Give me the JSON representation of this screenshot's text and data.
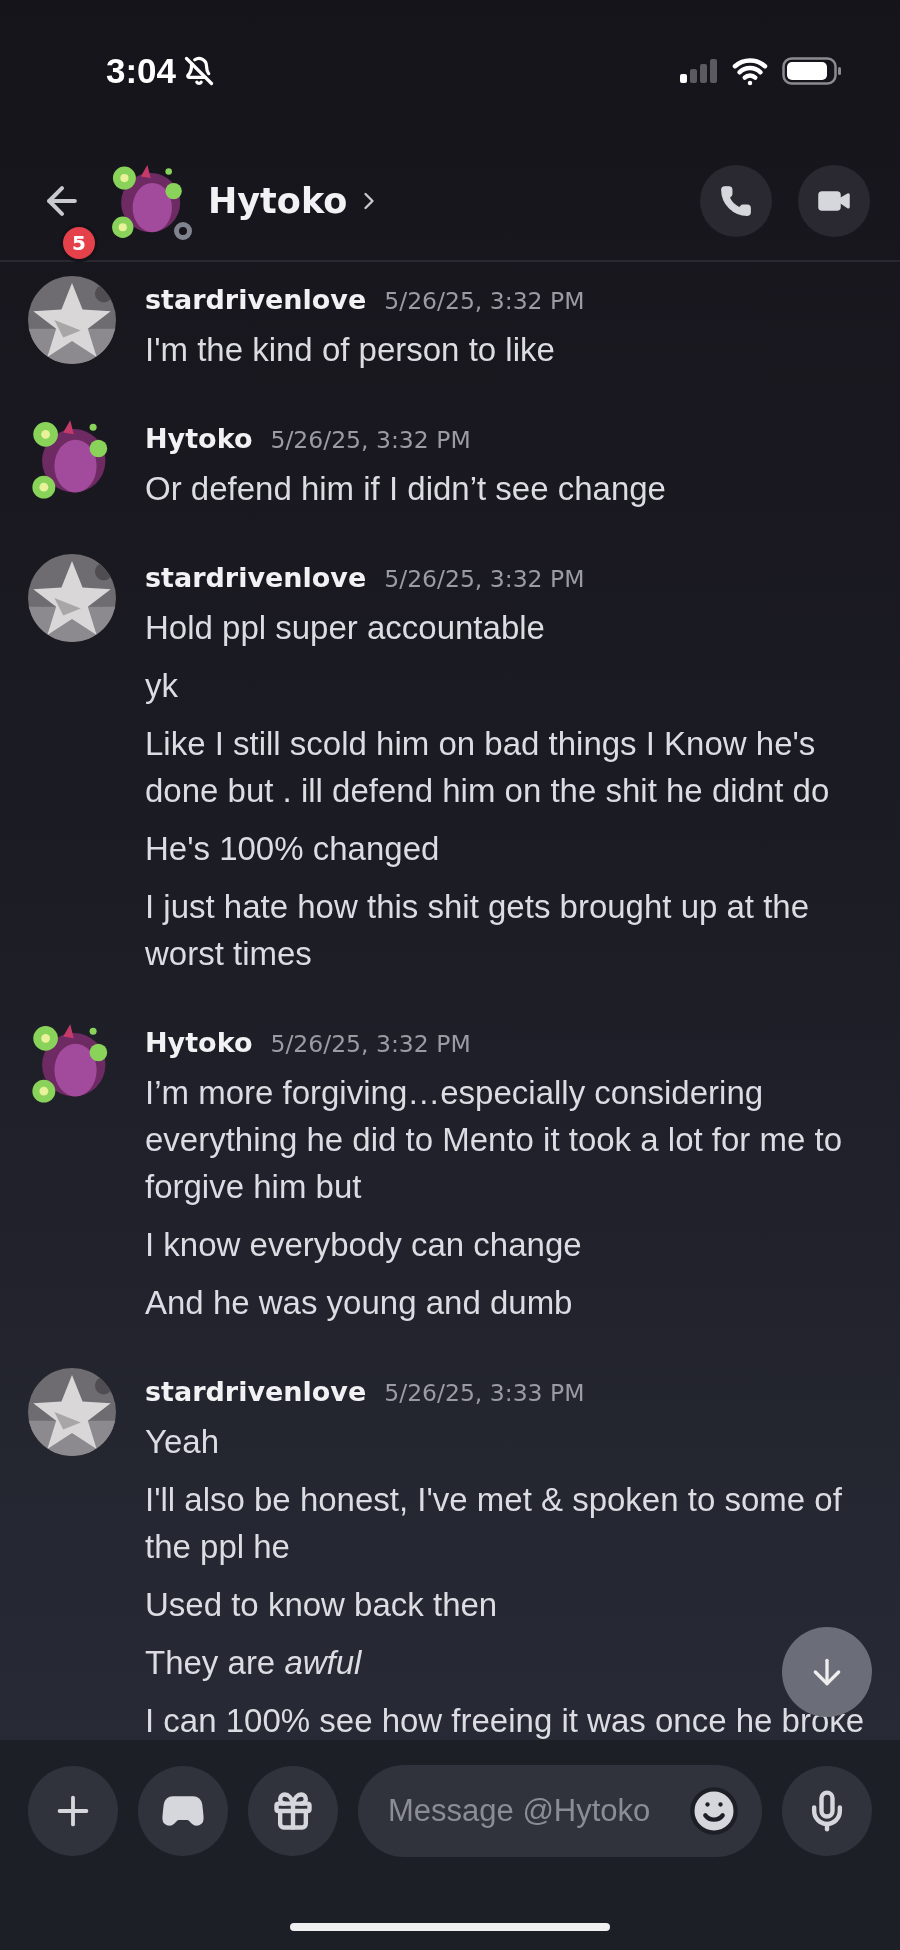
{
  "status_bar": {
    "time": "3:04"
  },
  "header": {
    "unread_badge": "5",
    "name": "Hytoko"
  },
  "messages": [
    {
      "author": "stardrivenlove",
      "timestamp": "5/26/25, 3:32 PM",
      "lines": [
        "I'm the kind of person to like"
      ]
    },
    {
      "author": "Hytoko",
      "timestamp": "5/26/25, 3:32 PM",
      "lines": [
        "Or defend him if I didn’t see change"
      ]
    },
    {
      "author": "stardrivenlove",
      "timestamp": "5/26/25, 3:32 PM",
      "lines": [
        "Hold ppl super accountable",
        "yk",
        "Like I still scold him on bad things I Know he's done but . ill defend him on the shit he didnt do",
        "He's 100% changed",
        "I just hate how this shit gets brought up at the worst times"
      ]
    },
    {
      "author": "Hytoko",
      "timestamp": "5/26/25, 3:32 PM",
      "lines": [
        "I’m more forgiving…especially considering everything he did to Mento it took a lot for me to forgive him but",
        "I know everybody can change",
        "And he was young and dumb"
      ]
    },
    {
      "author": "stardrivenlove",
      "timestamp": "5/26/25, 3:33 PM",
      "lines": [
        "Yeah",
        "I'll also be honest, I've met & spoken to some of the ppl he",
        "Used to know back then",
        "They are *awful*",
        "I can 100% see how freeing it was once he broke"
      ]
    }
  ],
  "composer": {
    "placeholder": "Message @Hytoko"
  }
}
